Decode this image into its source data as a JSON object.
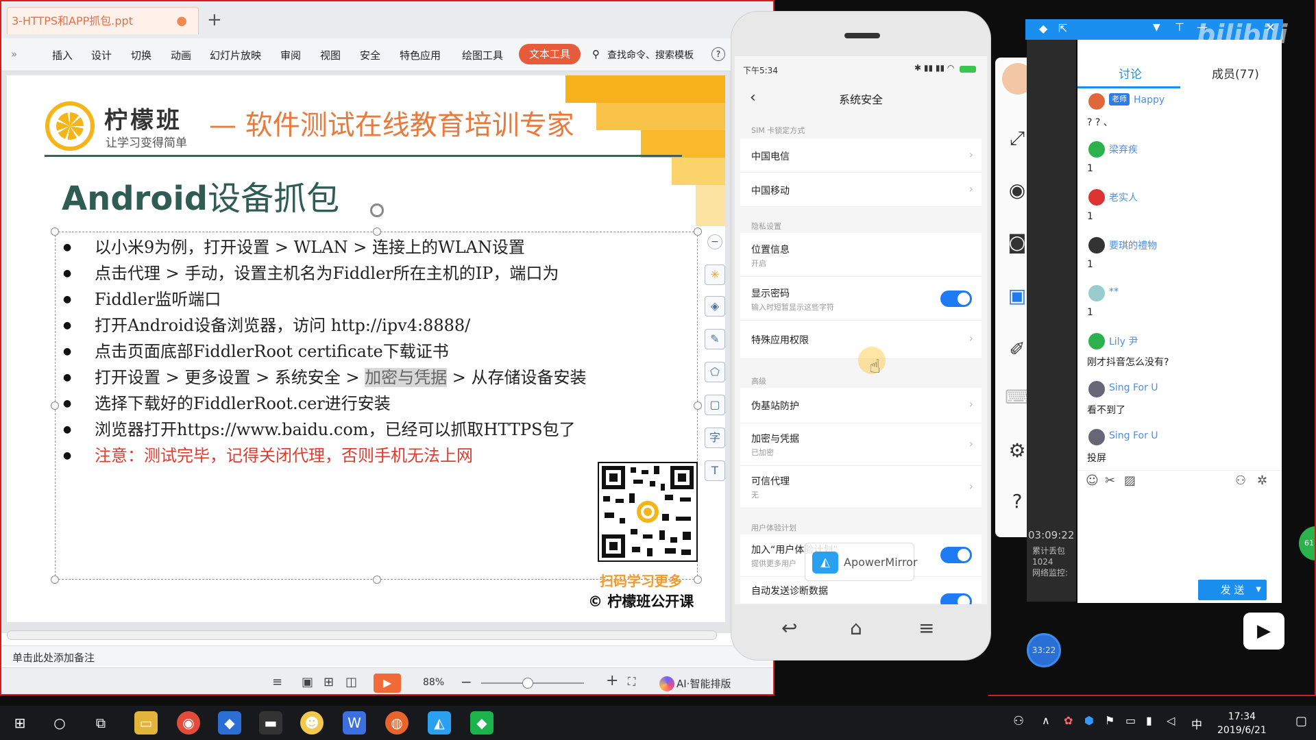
{
  "wps": {
    "doc_tab": "3-HTTPS和APP抓包.ppt",
    "add_tab": "+",
    "menu": [
      "插入",
      "设计",
      "切换",
      "动画",
      "幻灯片放映",
      "审阅",
      "视图",
      "安全",
      "特色应用",
      "绘图工具"
    ],
    "menu_text_tool": "文本工具",
    "search": "查找命令、搜索模板",
    "help": "?",
    "notes_placeholder": "单击此处添加备注",
    "zoom": "88%",
    "ai_label": "AI·智能排版"
  },
  "slide": {
    "brand_name": "柠檬班",
    "brand_slogan": "让学习变得简单",
    "tagline": "— 软件测试在线教育培训专家",
    "title_en": "Android",
    "title_cn": "设备抓包",
    "bullets": [
      "以小米9为例，打开设置 > WLAN > 连接上的WLAN设置",
      "点击代理 > 手动，设置主机名为Fiddler所在主机的IP，端口为",
      "打开Android设备浏览器，访问 http://ipv4:8888/",
      "点击页面底部FiddlerRoot certificate下载证书",
      "选择下载好的FiddlerRoot.cer进行安装",
      "浏览器打开https://www.baidu.com，已经可以抓取HTTPS包了",
      "注意：测试完毕，记得关闭代理，否则手机无法上网"
    ],
    "bullet2_cont": "Fiddler监听端口",
    "bullet5_a": "打开设置 > 更多设置 > 系统安全 > ",
    "bullet5_hl": "加密与凭据",
    "bullet5_b": " > 从存储设备安装",
    "qr_caption": "扫码学习更多",
    "copyright": "© 柠檬班公开课"
  },
  "phone": {
    "status_time": "下午5:34",
    "nav_title": "系统安全",
    "sections": {
      "sim": "SIM 卡锁定方式",
      "privacy": "隐私设置",
      "advanced": "高级",
      "ux": "用户体验计划"
    },
    "rows": {
      "telecom": "中国电信",
      "mobile": "中国移动",
      "location": "位置信息",
      "location_sub": "开启",
      "show_password": "显示密码",
      "show_password_sub": "输入时短暂显示这些字符",
      "special_access": "特殊应用权限",
      "fake_station": "伪基站防护",
      "encryption": "加密与凭据",
      "encryption_sub": "已加密",
      "trusted_agent": "可信代理",
      "trusted_agent_sub": "无",
      "join_ux": "加入“用户体验计划”",
      "join_ux_sub": "提供更多用户",
      "auto_diag": "自动发送诊断数据"
    },
    "mirror_brand": "ApowerMirror"
  },
  "chat": {
    "tab_discuss": "讨论",
    "tab_members": "成员(77)",
    "teacher_badge": "老师",
    "messages": [
      {
        "name": "Happy",
        "text": "? ? 、",
        "color": "#e0673a"
      },
      {
        "name": "梁弃疾",
        "text": "1",
        "color": "#2bb24c"
      },
      {
        "name": "老实人",
        "text": "1",
        "color": "#d33"
      },
      {
        "name": "要琪的禮物",
        "text": "1",
        "color": "#333"
      },
      {
        "name": "**",
        "text": "1",
        "color": "#7ab"
      },
      {
        "name": "Lily 尹",
        "text": "刚才抖音怎么没有?",
        "color": "#2bb24c"
      },
      {
        "name": "Sing For U",
        "text": "看不到了",
        "color": "#556"
      },
      {
        "name": "Sing For U",
        "text": "投屏",
        "color": "#556"
      }
    ],
    "send": "发 送",
    "timer": "03:09:22",
    "stats_1": "累计丢包",
    "stats_2": "1024",
    "stats_3": "网络监控:",
    "time_bubble": "33:22",
    "green_bubble": "61"
  },
  "taskbar": {
    "clock_time": "17:34",
    "clock_date": "2019/6/21",
    "ime": "中"
  }
}
